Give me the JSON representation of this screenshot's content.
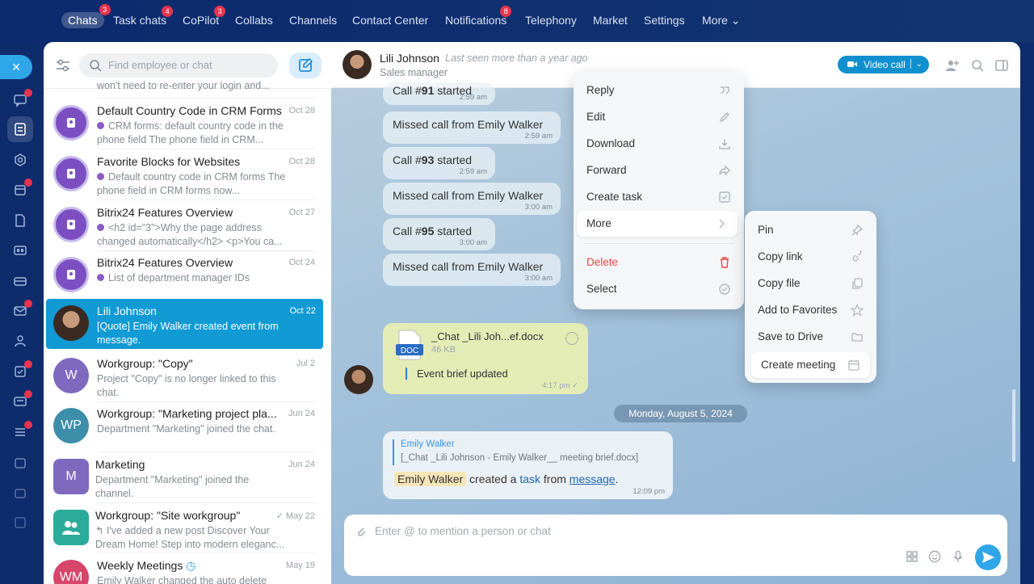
{
  "topnav": {
    "items": [
      {
        "label": "Chats",
        "badge": "3"
      },
      {
        "label": "Task chats",
        "badge": "4"
      },
      {
        "label": "CoPilot",
        "badge": "3"
      },
      {
        "label": "Collabs",
        "badge": ""
      },
      {
        "label": "Channels",
        "badge": ""
      },
      {
        "label": "Contact Center",
        "badge": ""
      },
      {
        "label": "Notifications",
        "badge": "8"
      },
      {
        "label": "Telephony",
        "badge": ""
      },
      {
        "label": "Market",
        "badge": ""
      },
      {
        "label": "Settings",
        "badge": ""
      },
      {
        "label": "More ⌄",
        "badge": ""
      }
    ]
  },
  "sidebar": {
    "search_placeholder": "Find employee or chat"
  },
  "chat_list": [
    {
      "title": "",
      "date": "",
      "preview": "won't need to re-enter your login and..."
    },
    {
      "title": "Default Country Code in CRM Forms",
      "date": "Oct 28",
      "preview": "CRM forms: default country code in the phone field The phone field in CRM..."
    },
    {
      "title": "Favorite Blocks for Websites",
      "date": "Oct 28",
      "preview": "Default country code in CRM forms The phone field in CRM forms now..."
    },
    {
      "title": "Bitrix24 Features Overview",
      "date": "Oct 27",
      "preview": "<h2 id=\"3\">Why the page address changed automatically</h2> <p>You ca..."
    },
    {
      "title": "Bitrix24 Features Overview",
      "date": "Oct 24",
      "preview": "List of department manager IDs"
    },
    {
      "title": "Lili Johnson",
      "date": "Oct 22",
      "preview": "[Quote] Emily Walker created event from message."
    },
    {
      "title": "Workgroup: \"Copy\"",
      "date": "Jul 2",
      "preview": "Project \"Copy\" is no longer linked to this chat.",
      "initials": "W"
    },
    {
      "title": "Workgroup: \"Marketing project pla...",
      "date": "Jun 24",
      "preview": "Department \"Marketing\" joined the chat.",
      "initials": "WP"
    },
    {
      "title": "Marketing",
      "date": "Jun 24",
      "preview": "Department \"Marketing\" joined the channel.",
      "initials": "M"
    },
    {
      "title": "Workgroup: \"Site workgroup\"",
      "date": "✓ May 22",
      "preview": "↰ I've added a new post Discover Your Dream Home! Step into modern eleganc..."
    },
    {
      "title": "Weekly Meetings",
      "date": "May 19",
      "preview": "Emily Walker changed the auto delete",
      "initials": "WM"
    }
  ],
  "header": {
    "name": "Lili Johnson",
    "last_seen": "Last seen more than a year ago",
    "role": "Sales manager",
    "video_call": "Video call"
  },
  "messages": [
    {
      "text_pre": "Call #",
      "num": "91",
      "text_post": " started",
      "time": "2:59 am"
    },
    {
      "text": "Missed call from Emily Walker",
      "time": "2:59 am"
    },
    {
      "text_pre": "Call #",
      "num": "93",
      "text_post": " started",
      "time": "2:59 am"
    },
    {
      "text": "Missed call from Emily Walker",
      "time": "3:00 am"
    },
    {
      "text_pre": "Call #",
      "num": "95",
      "text_post": " started",
      "time": "3:00 am"
    },
    {
      "text": "Missed call from Emily Walker",
      "time": "3:00 am"
    }
  ],
  "file_message": {
    "doc_label": "DOC",
    "file_name": "_Chat _Lili Joh...ef.docx",
    "file_size": "46 KB",
    "text": "Event brief updated",
    "time": "4:17 pm ✓"
  },
  "day_separator": "Monday, August 5, 2024",
  "quote_message": {
    "author": "Emily Walker",
    "quote": "[_Chat _Lili Johnson - Emily Walker__ meeting brief.docx]",
    "mention": "Emily Walker",
    "t1": " created a ",
    "link1": "task",
    "t2": " from ",
    "link2": "message",
    "t3": ".",
    "time": "12:09 pm"
  },
  "composer": {
    "placeholder": "Enter @ to mention a person or chat"
  },
  "context_menu": {
    "items": [
      "Reply",
      "Edit",
      "Download",
      "Forward",
      "Create task",
      "More",
      "Delete",
      "Select"
    ]
  },
  "submenu": {
    "items": [
      "Pin",
      "Copy link",
      "Copy file",
      "Add to Favorites",
      "Save to Drive",
      "Create meeting"
    ]
  },
  "colors": {
    "accent": "#2fa6e8",
    "selected_chat": "#119ad4",
    "badge": "#e8344e",
    "danger": "#e64747",
    "purple": "#8a5cc6"
  }
}
